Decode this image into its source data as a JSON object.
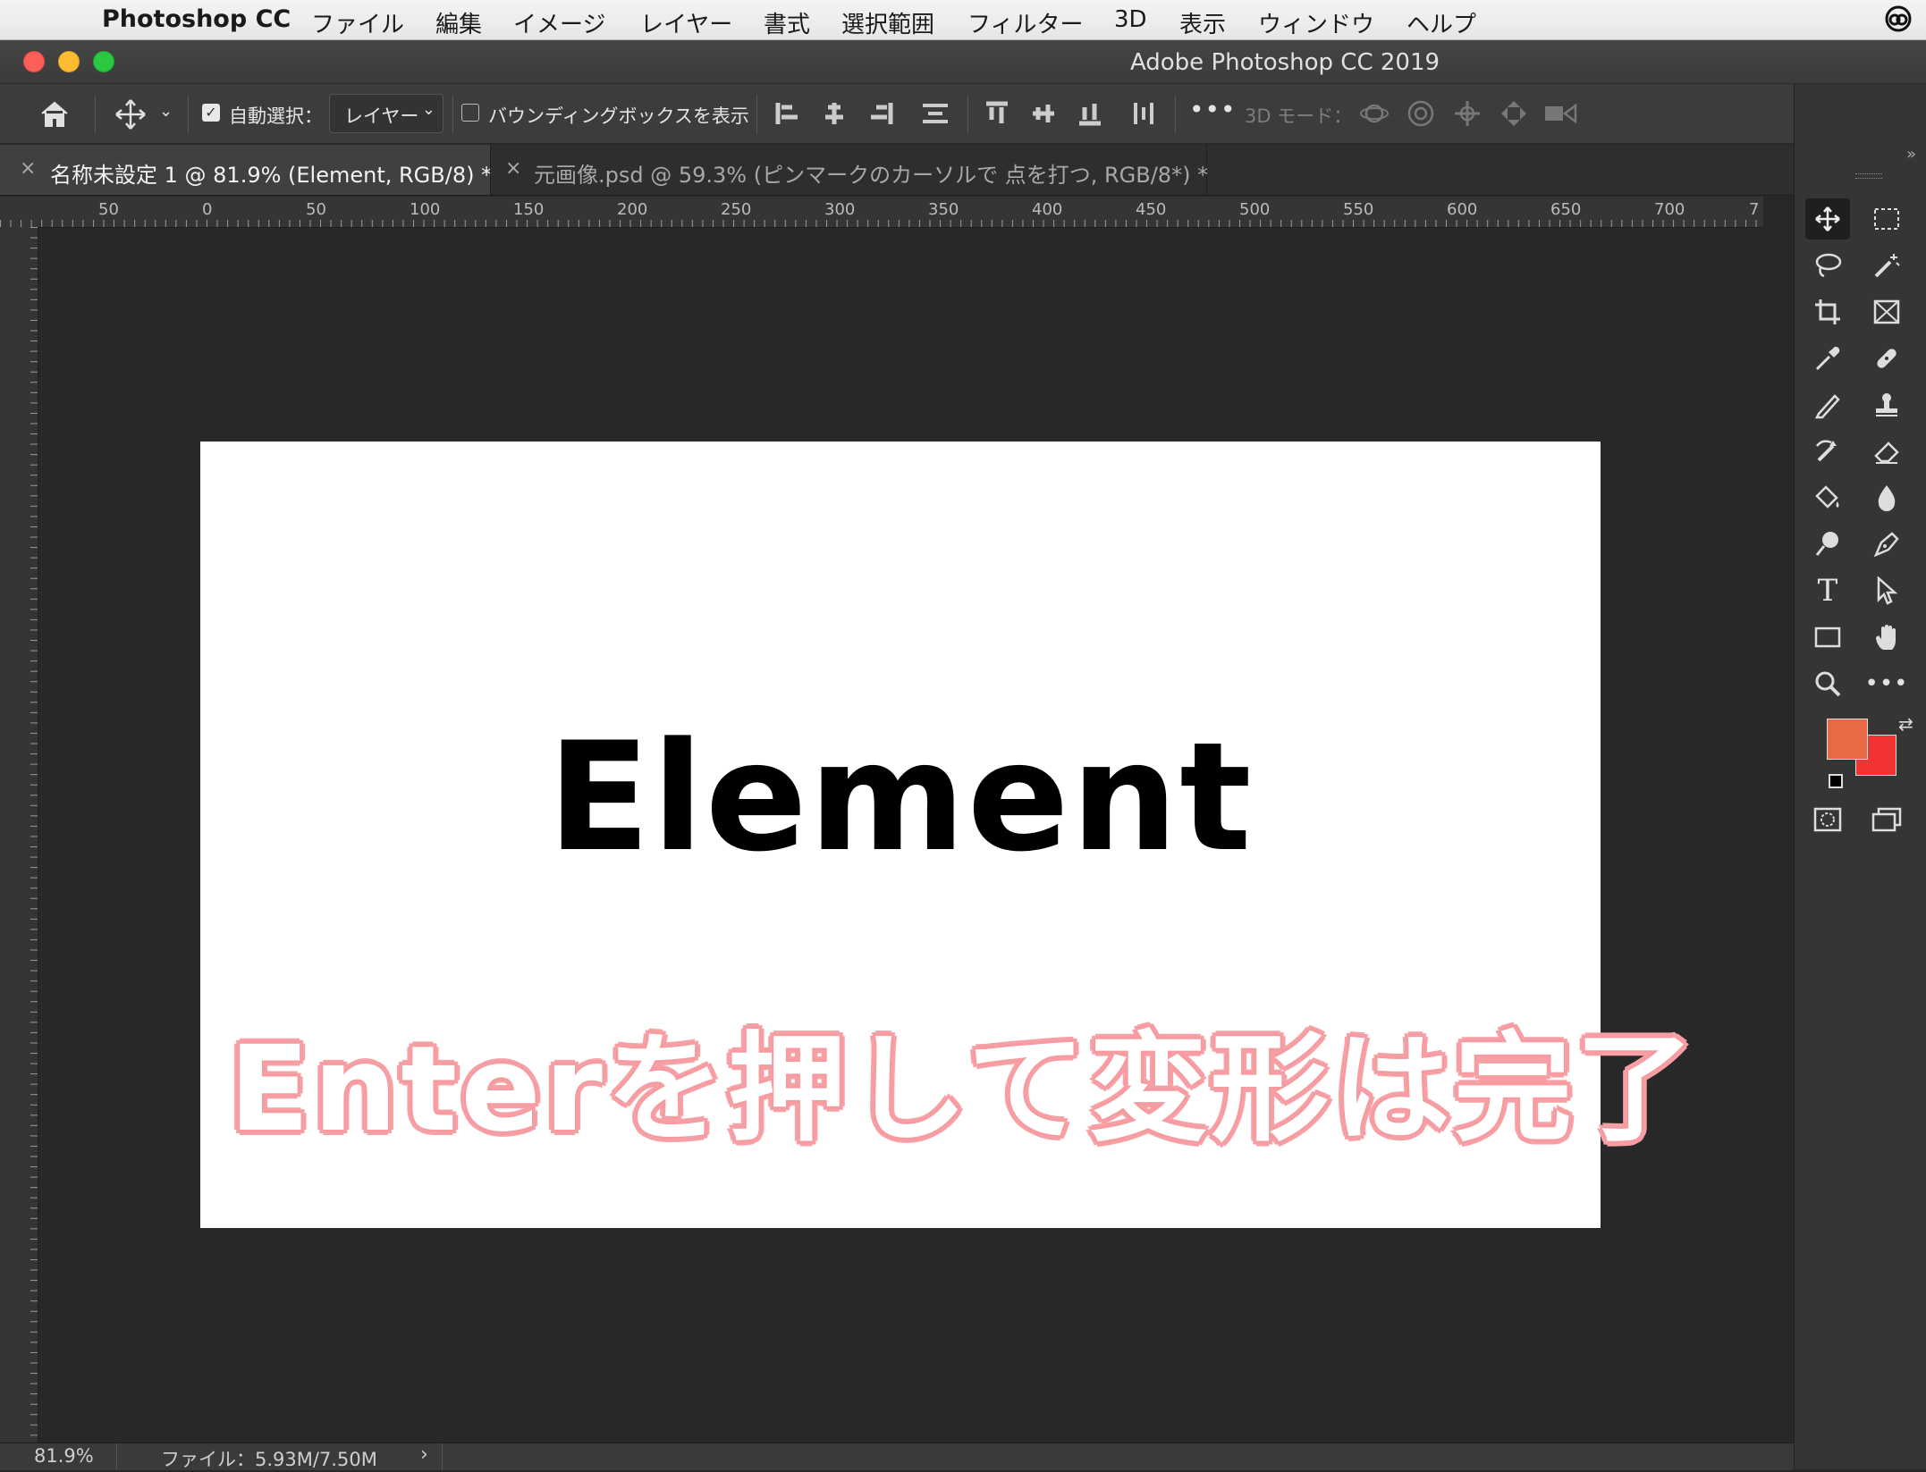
{
  "menubar": {
    "app_name": "Photoshop CC",
    "items": [
      "ファイル",
      "編集",
      "イメージ",
      "レイヤー",
      "書式",
      "選択範囲",
      "フィルター",
      "3D",
      "表示",
      "ウィンドウ",
      "ヘルプ"
    ]
  },
  "window": {
    "title": "Adobe Photoshop CC 2019"
  },
  "options": {
    "auto_select_label": "自動選択：",
    "auto_select_checked": true,
    "auto_select_target": "レイヤー",
    "bounding_box_label": "バウンディングボックスを表示",
    "mode_3d_label": "3D モード："
  },
  "tabs": [
    {
      "label": "名称未設定 1 @ 81.9% (Element, RGB/8) *",
      "active": true
    },
    {
      "label": "元画像.psd @ 59.3% (ピンマークのカーソルで 点を打つ, RGB/8*) *",
      "active": false
    }
  ],
  "ruler": {
    "h_labels": [
      "50",
      "0",
      "50",
      "100",
      "150",
      "200",
      "250",
      "300",
      "350",
      "400",
      "450",
      "500",
      "550",
      "600",
      "650",
      "700",
      "7"
    ]
  },
  "canvas": {
    "text": "Element",
    "caption": "Enterを押して変形は完了"
  },
  "status": {
    "zoom": "81.9%",
    "file_info": "ファイル：5.93M/7.50M"
  },
  "colors": {
    "foreground": "#e86a45",
    "background": "#f23333",
    "caption_outline": "#f7a1a6"
  }
}
